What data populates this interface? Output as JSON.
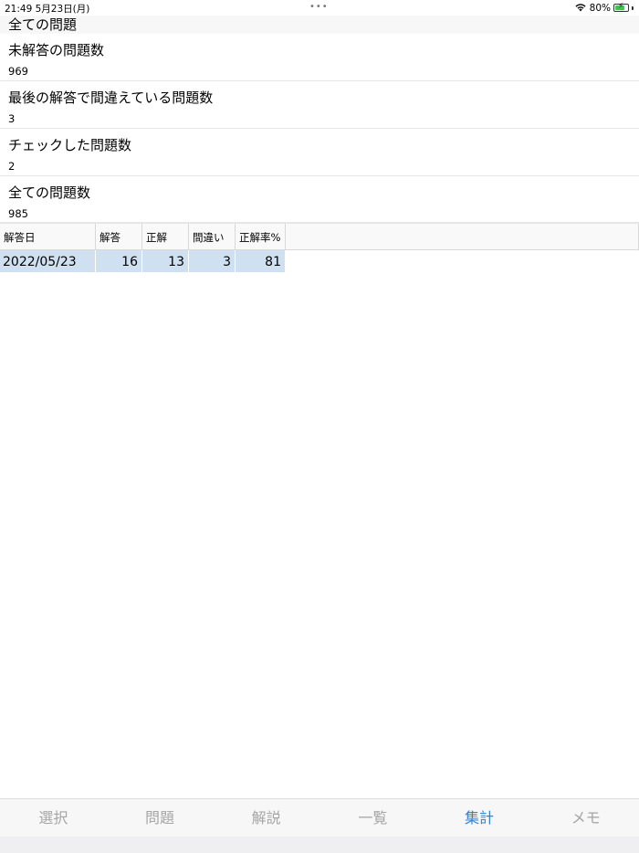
{
  "status_bar": {
    "time_date": "21:49  5月23日(月)",
    "dots": "•••",
    "battery_percent": "80%",
    "battery_level": 0.8,
    "icons": [
      "wifi-icon",
      "battery-icon"
    ]
  },
  "header": {
    "title": "全ての問題"
  },
  "stats": [
    {
      "label": "未解答の問題数",
      "value": "969"
    },
    {
      "label": "最後の解答で間違えている問題数",
      "value": "3"
    },
    {
      "label": "チェックした問題数",
      "value": "2"
    },
    {
      "label": "全ての問題数",
      "value": "985"
    }
  ],
  "table": {
    "columns": [
      "解答日",
      "解答",
      "正解",
      "間違い",
      "正解率%"
    ],
    "rows": [
      [
        "2022/05/23",
        "16",
        "13",
        "3",
        "81"
      ]
    ]
  },
  "tab_bar": {
    "tabs": [
      "選択",
      "問題",
      "解説",
      "一覧",
      "集計",
      "メモ"
    ],
    "active_index": 4
  },
  "colors": {
    "accent": "#2e83d6",
    "selected_row": "#cfe0f0",
    "tab_inactive": "#a5a5a5"
  }
}
